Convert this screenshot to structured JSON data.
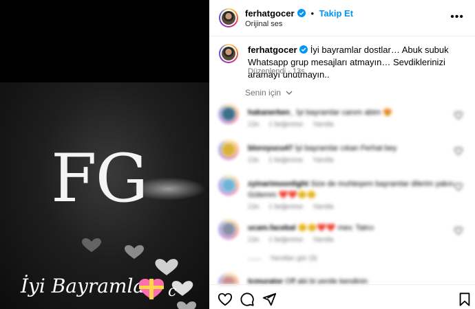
{
  "media": {
    "logo_text": "FG",
    "greeting": "İyi Bayramlar",
    "greeting_suffix": "c"
  },
  "header": {
    "username": "ferhatgocer",
    "follow_label": "Takip Et",
    "audio_label": "Orijinal ses",
    "more_label": "•••"
  },
  "caption": {
    "username": "ferhatgocer",
    "text": "İyi bayramlar dostlar… Abuk subuk Whatsapp grup mesajları atmayın… Sevdiklerinizi aramayı unutmayın..",
    "edited": "Düzenlendi",
    "age": "13s"
  },
  "for_you": "Senin için",
  "comments": [
    {
      "user": "hakanerken_",
      "text": "İyi bayramlar canım abim 😍",
      "age": "13s",
      "likes": "1 beğenme",
      "reply": "Yanıtla"
    },
    {
      "user": "bloroyucu47",
      "text": "İyi bayramlar cıkan Ferhat bey",
      "age": "13s",
      "likes": "1 beğenme",
      "reply": "Yanıtla"
    },
    {
      "user": "zyinarimoonlight",
      "text": "Size de muhteşem bayramlar dilerim yakın Gülemm ❤️❤️😊😊",
      "age": "13s",
      "likes": "1 beğenme",
      "reply": "Yanıtla"
    },
    {
      "user": "ucam.facebal",
      "text": "😊😊❤️❤️ mev. Tatrcı",
      "age": "13s",
      "likes": "1 beğenme",
      "reply": "Yanıtla"
    },
    {
      "user": "tcmurator",
      "text": "Off abi bi yenile kendinin",
      "age": "",
      "likes": "",
      "reply": ""
    }
  ],
  "view_replies": "Yanıtları gör (3)",
  "colors": {
    "accent_blue": "#0095f6",
    "muted": "#737373",
    "heart_red": "#ed4956"
  },
  "icons": [
    "heart-icon",
    "comment-icon",
    "share-icon",
    "bookmark-icon",
    "verified-badge-icon",
    "more-options-icon"
  ]
}
